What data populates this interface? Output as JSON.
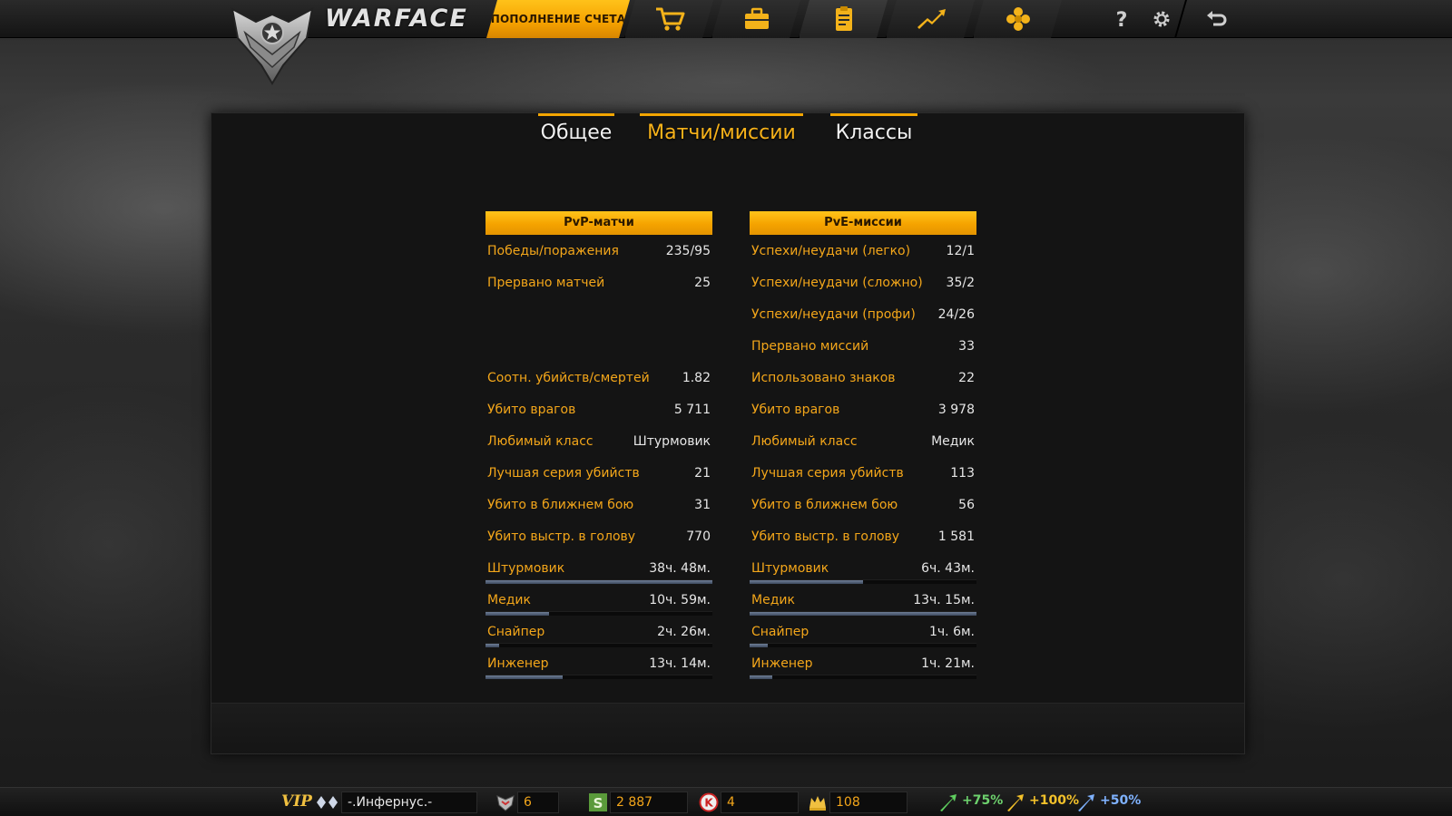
{
  "topbar": {
    "logo_text": "WARFACE",
    "topup_label": "ПОПОЛНЕНИЕ СЧЕТА",
    "nav": [
      {
        "icon": "shopping-cart-icon"
      },
      {
        "icon": "inventory-box-icon"
      },
      {
        "icon": "stats-clipboard-icon"
      },
      {
        "icon": "rating-arrow-icon"
      },
      {
        "icon": "achievements-flower-icon"
      }
    ],
    "help_icon": "help-icon",
    "settings_icon": "gear-icon",
    "exit_icon": "logout-icon"
  },
  "tabs": [
    {
      "label": "Общее"
    },
    {
      "label": "Матчи/миссии"
    },
    {
      "label": "Классы"
    }
  ],
  "pvp": {
    "title": "PvP-матчи",
    "rows": [
      {
        "label": "Победы/поражения",
        "value": "235/95"
      },
      {
        "label": "Прервано матчей",
        "value": "25"
      },
      {
        "label": "Соотн. убийств/смертей",
        "value": "1.82"
      },
      {
        "label": "Убито врагов",
        "value": "5 711"
      },
      {
        "label": "Любимый класс",
        "value": "Штурмовик"
      },
      {
        "label": "Лучшая серия убийств",
        "value": "21"
      },
      {
        "label": "Убито в ближнем бою",
        "value": "31"
      },
      {
        "label": "Убито выстр. в голову",
        "value": "770"
      }
    ],
    "classes": [
      {
        "label": "Штурмовик",
        "value": "38ч. 48м.",
        "fraction": 1.0
      },
      {
        "label": "Медик",
        "value": "10ч. 59м.",
        "fraction": 0.28
      },
      {
        "label": "Снайпер",
        "value": "2ч. 26м.",
        "fraction": 0.06
      },
      {
        "label": "Инженер",
        "value": "13ч. 14м.",
        "fraction": 0.34
      }
    ]
  },
  "pve": {
    "title": "PvE-миссии",
    "rows": [
      {
        "label": "Успехи/неудачи (легко)",
        "value": "12/1"
      },
      {
        "label": "Успехи/неудачи (сложно)",
        "value": "35/2"
      },
      {
        "label": "Успехи/неудачи (профи)",
        "value": "24/26"
      },
      {
        "label": "Прервано миссий",
        "value": "33"
      },
      {
        "label": "Использовано знаков",
        "value": "22"
      },
      {
        "label": "Убито врагов",
        "value": "3 978"
      },
      {
        "label": "Любимый класс",
        "value": "Медик"
      },
      {
        "label": "Лучшая серия убийств",
        "value": "113"
      },
      {
        "label": "Убито в ближнем бою",
        "value": "56"
      },
      {
        "label": "Убито выстр. в голову",
        "value": "1 581"
      }
    ],
    "classes": [
      {
        "label": "Штурмовик",
        "value": "6ч. 43м.",
        "fraction": 0.5
      },
      {
        "label": "Медик",
        "value": "13ч. 15м.",
        "fraction": 1.0
      },
      {
        "label": "Снайпер",
        "value": "1ч. 6м.",
        "fraction": 0.08
      },
      {
        "label": "Инженер",
        "value": "1ч. 21м.",
        "fraction": 0.1
      }
    ]
  },
  "bottombar": {
    "vip": "VIP",
    "nickname": "-.Инфернус.-",
    "rank": "6",
    "money": "2 887",
    "kredits": "4",
    "crowns": "108",
    "boost_xp": "+75%",
    "boost_money": "+100%",
    "boost_vp": "+50%"
  },
  "colors": {
    "accent": "#f5a300",
    "label": "#f3a61a",
    "value": "#e6e6e6",
    "bar": "#5a6a82"
  }
}
